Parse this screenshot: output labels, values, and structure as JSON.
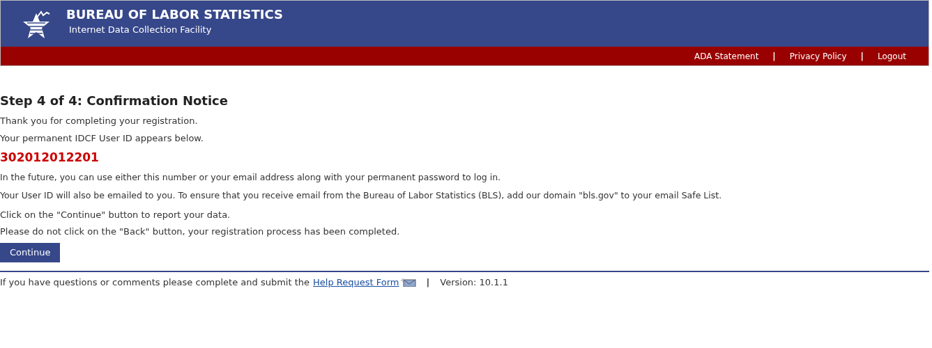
{
  "header": {
    "title": "BUREAU OF LABOR STATISTICS",
    "subtitle": "Internet Data Collection Facility"
  },
  "nav": {
    "links": [
      "ADA Statement",
      "Privacy Policy",
      "Logout"
    ],
    "separator": "|"
  },
  "content": {
    "heading": "Step 4 of 4: Confirmation Notice",
    "intro": [
      "Thank you for completing your registration.",
      "Your permanent IDCF User ID appears below."
    ],
    "user_id": "302012012201",
    "notes": [
      "In the future, you can use either this number or your email address along with your permanent password to log in.",
      "Your User ID will also be emailed to you. To ensure that you receive email from the Bureau of Labor Statistics (BLS), add our domain \"bls.gov\" to your email Safe List."
    ],
    "instructions": [
      "Click on the \"Continue\" button to report your data.",
      "Please do not click on the \"Back\" button, your registration process has been completed."
    ],
    "button": "Continue"
  },
  "footer": {
    "text": "If you have questions or comments please complete and submit the",
    "link": "Help Request Form",
    "separator": "|",
    "version": "Version: 10.1.1"
  }
}
